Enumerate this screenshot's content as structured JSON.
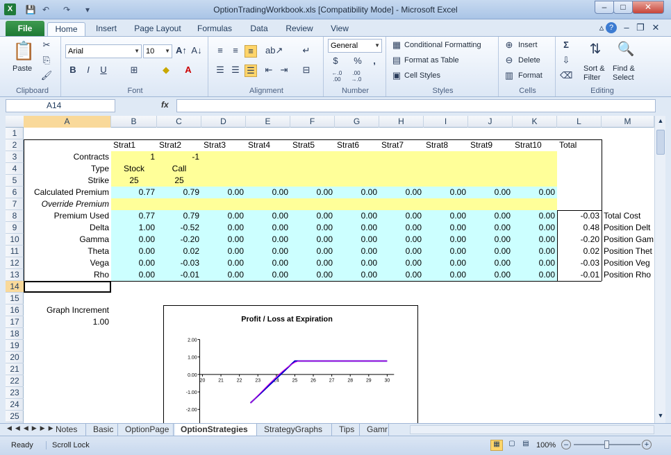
{
  "window": {
    "title": "OptionTradingWorkbook.xls  [Compatibility Mode]  -  Microsoft Excel",
    "app_icon": "X"
  },
  "ribbon_tabs": [
    "File",
    "Home",
    "Insert",
    "Page Layout",
    "Formulas",
    "Data",
    "Review",
    "View"
  ],
  "clipboard": {
    "paste": "Paste",
    "label": "Clipboard"
  },
  "font": {
    "name": "Arial",
    "size": "10",
    "label": "Font",
    "bold": "B",
    "italic": "I",
    "underline": "U"
  },
  "alignment": {
    "label": "Alignment"
  },
  "number": {
    "format": "General",
    "currency": "$",
    "percent": "%",
    "comma": ",",
    "label": "Number",
    "inc": "←.0 .00",
    "dec": ".00 →.0"
  },
  "styles": {
    "conditional": "Conditional Formatting",
    "format_table": "Format as Table",
    "cell_styles": "Cell Styles",
    "label": "Styles"
  },
  "cells": {
    "insert": "Insert",
    "delete": "Delete",
    "format": "Format",
    "label": "Cells"
  },
  "editing": {
    "sum": "Σ",
    "sort": "Sort &",
    "sort2": "Filter",
    "find": "Find &",
    "find2": "Select",
    "label": "Editing"
  },
  "formula_bar": {
    "namebox": "A14",
    "fx": "fx",
    "value": ""
  },
  "columns": [
    "A",
    "B",
    "C",
    "D",
    "E",
    "F",
    "G",
    "H",
    "I",
    "J",
    "K",
    "L",
    "M"
  ],
  "rows": [
    "1",
    "2",
    "3",
    "4",
    "5",
    "6",
    "7",
    "8",
    "9",
    "10",
    "11",
    "12",
    "13",
    "14",
    "15",
    "16",
    "17",
    "18",
    "19",
    "20",
    "21",
    "22",
    "23",
    "24",
    "25"
  ],
  "sheet": {
    "headers": [
      "Strat1",
      "Strat2",
      "Strat3",
      "Strat4",
      "Strat5",
      "Strat6",
      "Strat7",
      "Strat8",
      "Strat9",
      "Strat10",
      "Total"
    ],
    "labels": {
      "contracts": "Contracts",
      "type": "Type",
      "strike": "Strike",
      "calc": "Calculated Premium",
      "override": "Override Premium",
      "used": "Premium Used",
      "delta": "Delta",
      "gamma": "Gamma",
      "theta": "Theta",
      "vega": "Vega",
      "rho": "Rho",
      "graph_inc": "Graph Increment"
    },
    "contracts": [
      "1",
      "-1"
    ],
    "type": [
      "Stock",
      "Call"
    ],
    "strike": [
      "25",
      "25"
    ],
    "calc": [
      "0.77",
      "0.79",
      "0.00",
      "0.00",
      "0.00",
      "0.00",
      "0.00",
      "0.00",
      "0.00",
      "0.00"
    ],
    "used": [
      "0.77",
      "0.79",
      "0.00",
      "0.00",
      "0.00",
      "0.00",
      "0.00",
      "0.00",
      "0.00",
      "0.00",
      "-0.03"
    ],
    "delta": [
      "1.00",
      "-0.52",
      "0.00",
      "0.00",
      "0.00",
      "0.00",
      "0.00",
      "0.00",
      "0.00",
      "0.00",
      "0.48"
    ],
    "gamma": [
      "0.00",
      "-0.20",
      "0.00",
      "0.00",
      "0.00",
      "0.00",
      "0.00",
      "0.00",
      "0.00",
      "0.00",
      "-0.20"
    ],
    "theta": [
      "0.00",
      "0.02",
      "0.00",
      "0.00",
      "0.00",
      "0.00",
      "0.00",
      "0.00",
      "0.00",
      "0.00",
      "0.02"
    ],
    "vega": [
      "0.00",
      "-0.03",
      "0.00",
      "0.00",
      "0.00",
      "0.00",
      "0.00",
      "0.00",
      "0.00",
      "0.00",
      "-0.03"
    ],
    "rho": [
      "0.00",
      "-0.01",
      "0.00",
      "0.00",
      "0.00",
      "0.00",
      "0.00",
      "0.00",
      "0.00",
      "0.00",
      "-0.01"
    ],
    "totals_labels": [
      "Total Cost",
      "Position Delt",
      "Position Gam",
      "Position Thet",
      "Position Veg",
      "Position Rho"
    ],
    "graph_inc": "1.00"
  },
  "chart": {
    "title": "Profit / Loss at Expiration",
    "y_ticks": [
      "2.00",
      "1.00",
      "0.00",
      "-1.00",
      "-2.00"
    ],
    "x_ticks": [
      "20",
      "21",
      "22",
      "23",
      "24",
      "25",
      "26",
      "27",
      "28",
      "29",
      "30"
    ]
  },
  "sheet_tabs": [
    "Notes",
    "Basic",
    "OptionPage",
    "OptionStrategies",
    "StrategyGraphs",
    "Tips",
    "Gamr"
  ],
  "status": {
    "ready": "Ready",
    "scroll": "Scroll Lock",
    "zoom": "100%"
  }
}
